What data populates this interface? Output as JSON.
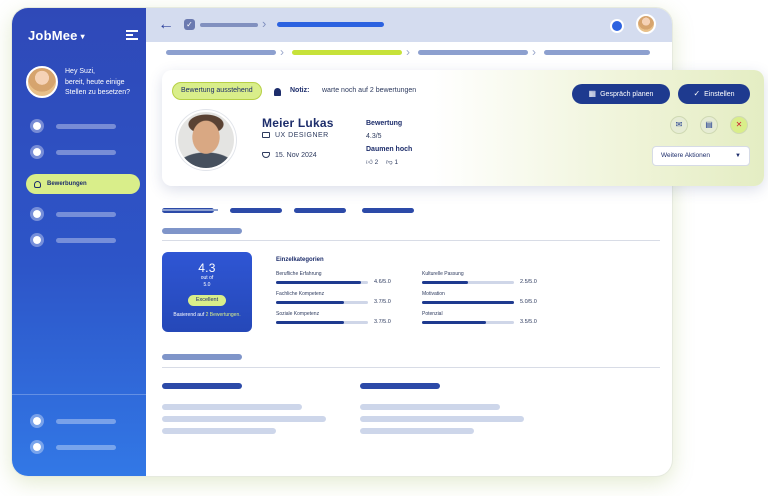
{
  "app": {
    "brand": "JobMee",
    "brand_caret": "▾"
  },
  "sidebar": {
    "greeting": "Hey Suzi,\nbereit, heute einige Stellen zu besetzen?",
    "active_item": "Bewerbungen"
  },
  "card": {
    "status_badge": "Bewertung ausstehend",
    "note_label": "Notiz:",
    "note_text": "warte noch auf 2 bewertungen",
    "schedule_button": "Gespräch planen",
    "hire_button": "Einstellen",
    "more_actions": "Weitere Aktionen",
    "name": "Meier Lukas",
    "role": "UX DESIGNER",
    "date": "15. Nov 2024",
    "rating_label": "Bewertung",
    "rating_value": "4.3/5",
    "thumbs_label": "Daumen hoch",
    "thumbs_up": "2",
    "thumbs_down": "1"
  },
  "score": {
    "value": "4.3",
    "out_of_1": "out of",
    "out_of_2": "5.0",
    "label": "Excellent",
    "based_prefix": "Basierend auf",
    "based_link": "2 Bewertungen."
  },
  "categories": {
    "title": "Einzelkategorien",
    "items": [
      {
        "name": "Berufliche Erfahrung",
        "value": "4.6/5.0",
        "fraction": 0.92
      },
      {
        "name": "Fachliche Kompetenz",
        "value": "3.7/5.0",
        "fraction": 0.74
      },
      {
        "name": "Soziale Kompetenz",
        "value": "3.7/5.0",
        "fraction": 0.74
      },
      {
        "name": "Kulturelle Passung",
        "value": "2.5/5.0",
        "fraction": 0.5
      },
      {
        "name": "Motivation",
        "value": "5.0/5.0",
        "fraction": 1.0
      },
      {
        "name": "Potenzial",
        "value": "3.5/5.0",
        "fraction": 0.7
      }
    ]
  },
  "colors": {
    "primary": "#1e3a8f",
    "accent": "#d9ee8a",
    "sidebar": "#2f49b8"
  }
}
